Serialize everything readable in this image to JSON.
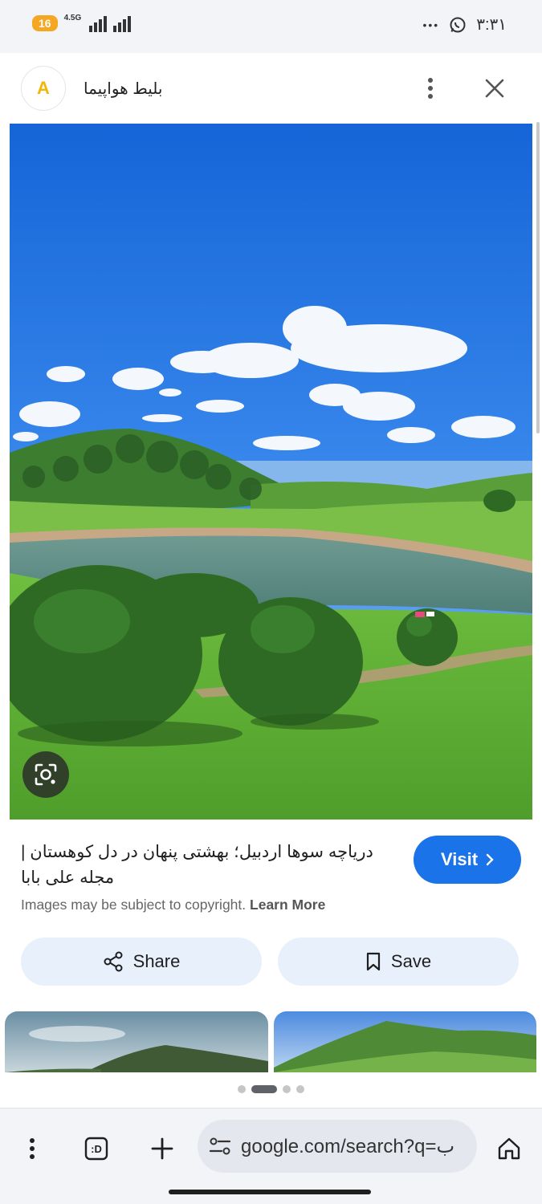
{
  "status_bar": {
    "badge": "16",
    "network": "4.5G",
    "time": "۳:۳۱",
    "more": "•••"
  },
  "header": {
    "logo_letter": "A",
    "title": "بلیط هواپیما"
  },
  "result": {
    "caption": "دریاچه سوها اردبیل؛ بهشتی پنهان در دل کوهستان | مجله علی بابا",
    "copyright_text": "Images may be subject to copyright.",
    "learn_more": "Learn More",
    "visit_label": "Visit"
  },
  "actions": {
    "share_label": "Share",
    "save_label": "Save"
  },
  "carousel": {
    "active_index": 1,
    "count": 4
  },
  "browser": {
    "url": "google.com/search?q=ب",
    "tab_icon_label": ":D"
  },
  "colors": {
    "accent": "#1a73e8",
    "pill_bg": "#e8f0fb",
    "sky": "#1f6fe0",
    "grass": "#5fae3a"
  }
}
